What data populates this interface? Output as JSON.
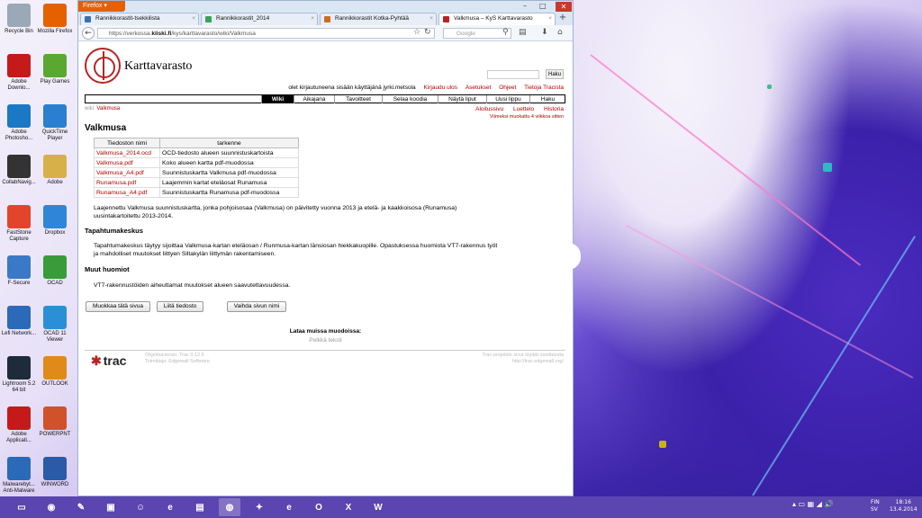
{
  "desktop": {
    "icons": [
      {
        "label": "Recycle Bin",
        "icon": "recycle-bin-icon",
        "color": "#9aa8b8"
      },
      {
        "label": "Mozilla Firefox",
        "icon": "firefox-icon",
        "color": "#e66000"
      },
      {
        "label": "Adobe Downlo...",
        "icon": "adobe-icon",
        "color": "#c41a1a"
      },
      {
        "label": "Play Games",
        "icon": "games-icon",
        "color": "#5aa832"
      },
      {
        "label": "Adobe Photosho...",
        "icon": "photoshop-icon",
        "color": "#1b78c4"
      },
      {
        "label": "QuickTime Player",
        "icon": "quicktime-icon",
        "color": "#2a7fd1"
      },
      {
        "label": "CollabNavig...",
        "icon": "collabnav-icon",
        "color": "#333333"
      },
      {
        "label": "Adobe",
        "icon": "folder-icon",
        "color": "#d8b04a"
      },
      {
        "label": "FastStone Capture",
        "icon": "faststone-icon",
        "color": "#e2452b"
      },
      {
        "label": "Dropbox",
        "icon": "dropbox-icon",
        "color": "#2f86d9"
      },
      {
        "label": "F-Secure",
        "icon": "fsecure-icon",
        "color": "#3a79c7"
      },
      {
        "label": "OCAD",
        "icon": "ocad-icon",
        "color": "#3a9b3a"
      },
      {
        "label": "Lefi Network...",
        "icon": "network-icon",
        "color": "#2a6ab8"
      },
      {
        "label": "OCAD 11 Viewer",
        "icon": "ocad-viewer-icon",
        "color": "#2b8fd8"
      },
      {
        "label": "Lightroom 5.2 64 bit",
        "icon": "lightroom-icon",
        "color": "#1d2b3a"
      },
      {
        "label": "OUTLOOK",
        "icon": "outlook-icon",
        "color": "#e08a1a"
      },
      {
        "label": "Adobe Applicati...",
        "icon": "adobe-app-icon",
        "color": "#c41a1a"
      },
      {
        "label": "POWERPNT",
        "icon": "powerpoint-icon",
        "color": "#d1512a"
      },
      {
        "label": "Malwarebyt... Anti-Malware",
        "icon": "malwarebytes-icon",
        "color": "#2a6ab8"
      },
      {
        "label": "WINWORD",
        "icon": "word-icon",
        "color": "#2a5aa8"
      }
    ]
  },
  "browser": {
    "app_button": "Firefox",
    "tabs": [
      {
        "label": "Rannikkorastit-tsekkilista",
        "active": false
      },
      {
        "label": "Rannikkorastit_2014",
        "active": false
      },
      {
        "label": "Rannikkorastit Kotka-Pyhtää",
        "active": false
      },
      {
        "label": "Valkmusa – KyS Karttavarasto",
        "active": true
      }
    ],
    "new_tab": "+",
    "url_prefix": "https://verkossa.",
    "url_domain": "kiiski.fi",
    "url_rest": "/kys/karttavarasto/wiki/Valkmusa",
    "search_placeholder": "Google"
  },
  "page": {
    "site_title": "Karttavarasto",
    "search_button": "Haku",
    "metanav": {
      "logged_in": "olet kirjautuneena sisään käyttäjänä jyrki.metsola",
      "links": [
        "Kirjaudu ulos",
        "Asetukset",
        "Ohjeet",
        "Tietoja Tracista"
      ]
    },
    "mainnav": [
      "Wiki",
      "Aikajana",
      "Tavoitteet",
      "Selaa koodia",
      "Näytä liput",
      "Uusi lippu",
      "Haku"
    ],
    "context_prefix": "wiki:",
    "context_page": "Valkmusa",
    "ctxnav": [
      "Aloitussivu",
      "Luettelo",
      "Historia"
    ],
    "last_modified": "Viimeksi muokattu 4 viikkoa sitten",
    "heading": "Valkmusa",
    "table": {
      "headers": [
        "Tiedoston nimi",
        "tarkenne"
      ],
      "rows": [
        [
          "Valkmusa_2014.ocd",
          "OCD-tiedosto alueen suunnistuskartoista"
        ],
        [
          "Valkmusa.pdf",
          "Koko alueen kartta pdf-muodossa"
        ],
        [
          "Valkmusa_A4.pdf",
          "Suunnistuskartta Valkmusa pdf-muodossa"
        ],
        [
          "Runamusa.pdf",
          "Laajemmin kartat eteläosat Runamusa"
        ],
        [
          "Runamusa_A4.pdf",
          "Suunnistuskartta Runamusa pdf-muodossa"
        ]
      ]
    },
    "intro_line1": "Laajennettu Valkmusa suunnistuskartta, jonka pohjoisosaa (Valkmusa) on päivitetty vuonna 2013 ja etelä- ja kaakkoisosa (Runamusa)",
    "intro_line2": "uusintakartoitettu 2013-2014.",
    "section1_title": "Tapahtumakeskus",
    "section1_line1": "Tapahtumakeskus täytyy sijoittaa Valkmusa-kartan eteläosan / Runmusa-kartan länsiosan hiekkakuopille. Opastuksessa huomiota VT7-rakennus työt",
    "section1_line2": "ja mahdolliset muutokset liittyen Siltakylän liittymän rakentamiseen.",
    "section2_title": "Muut huomiot",
    "section2_line1": "VT7-rakennustöiden aiheuttamat muutokset alueen saavutettavuudessa.",
    "buttons": [
      "Muokkaa tätä sivua",
      "Liitä tiedosto",
      "Vaihda sivun nimi"
    ],
    "download_title": "Lataa muissa muodoissa:",
    "download_link": "Pelkkä teksti",
    "footer_logo": "trac",
    "footer_left_1": "Ohjelmaversio: Trac 0.12.5",
    "footer_left_2": "Toimittaja: Edgewall Software.",
    "footer_right_1": "Trac-projektin sivut löydät osoitteesta",
    "footer_right_2": "http://trac.edgewall.org/"
  },
  "taskbar": {
    "apps": [
      "explorer-icon",
      "office-icon",
      "paint-icon",
      "window-icon",
      "user-icon",
      "ie-icon",
      "notepad-icon",
      "firefox-icon",
      "cat-icon",
      "ie2-icon",
      "outlook-icon",
      "excel-icon",
      "word-icon"
    ],
    "lang_1": "FIN",
    "lang_2": "SV",
    "time": "18:16",
    "date": "13.4.2014"
  }
}
